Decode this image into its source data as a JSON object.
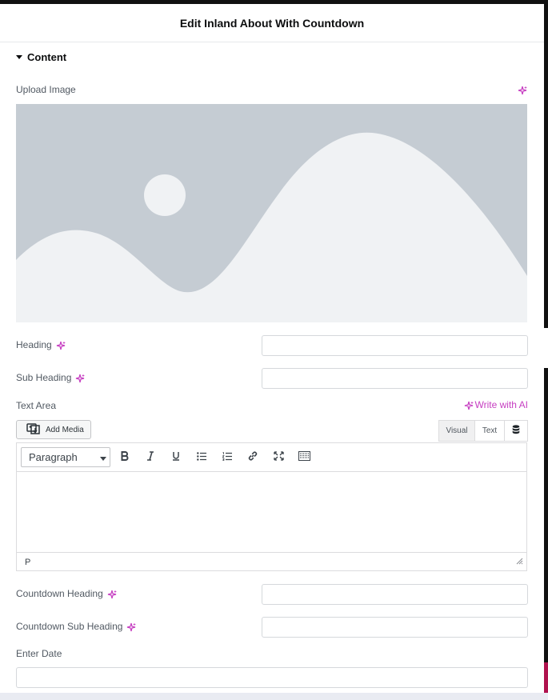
{
  "header": {
    "title": "Edit Inland About With Countdown"
  },
  "section": {
    "label": "Content"
  },
  "upload_image": {
    "label": "Upload Image"
  },
  "heading": {
    "label": "Heading",
    "value": ""
  },
  "sub_heading": {
    "label": "Sub Heading",
    "value": ""
  },
  "text_area": {
    "label": "Text Area",
    "write_ai_label": "Write with AI",
    "add_media_label": "Add Media",
    "tabs": {
      "visual": "Visual",
      "text": "Text"
    },
    "format_value": "Paragraph",
    "toolbar": [
      "bold-icon",
      "italic-icon",
      "underline-icon",
      "bullet-list-icon",
      "numbered-list-icon",
      "link-icon",
      "fullscreen-icon",
      "keyboard-icon"
    ],
    "status_path": "P"
  },
  "countdown_heading": {
    "label": "Countdown Heading",
    "value": ""
  },
  "countdown_sub_heading": {
    "label": "Countdown Sub Heading",
    "value": ""
  },
  "enter_date": {
    "label": "Enter Date",
    "value": ""
  },
  "colors": {
    "ai_accent": "#c63ec1",
    "placeholder_bg": "#c5ccd3",
    "placeholder_fg": "#f0f2f4"
  }
}
